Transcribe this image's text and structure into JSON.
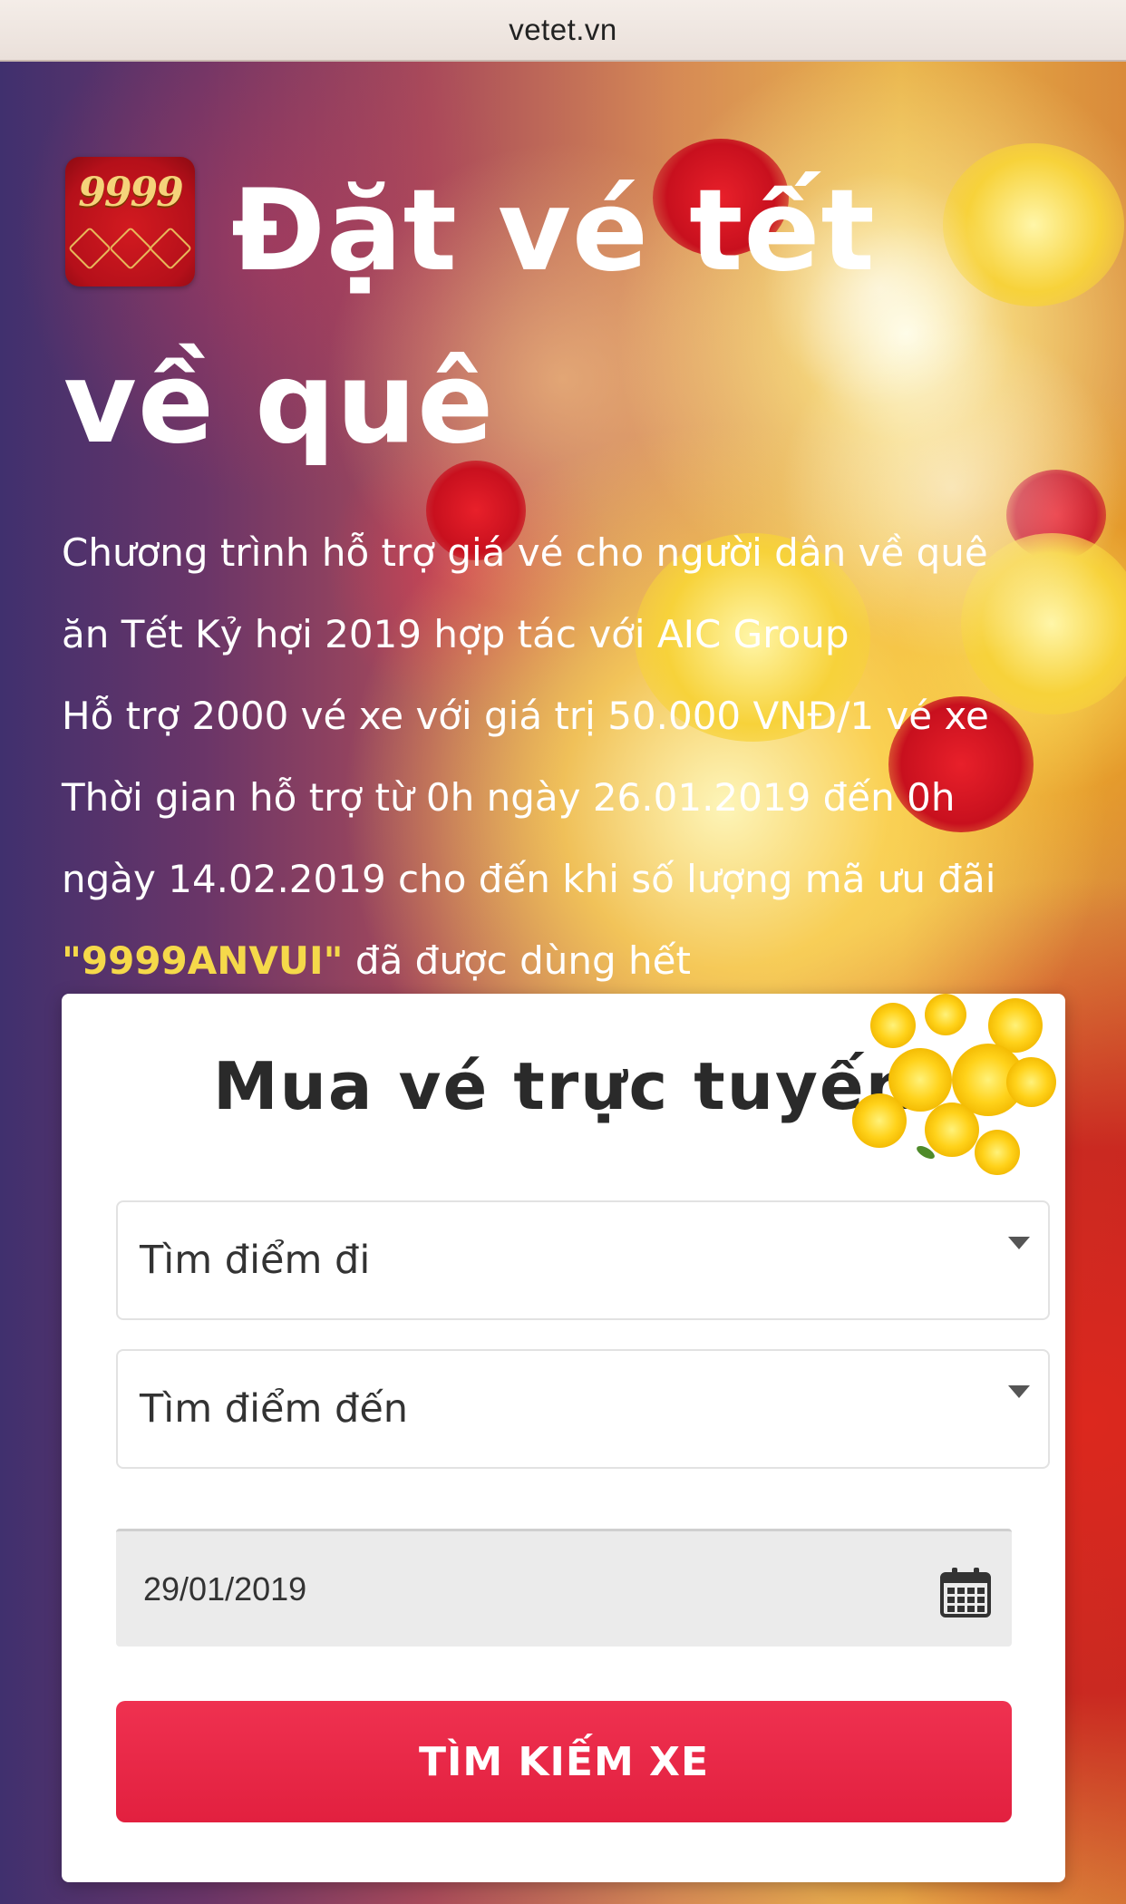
{
  "browser": {
    "url": "vetet.vn"
  },
  "hero": {
    "app_icon_text": "9999",
    "headline": "Đặt vé tết về quê",
    "description_lines": [
      "Chương trình hỗ trợ giá vé cho người dân về quê",
      "ăn Tết Kỷ hợi 2019 hợp tác với AIC Group",
      "Hỗ trợ 2000 vé xe với giá trị 50.000 VNĐ/1 vé xe",
      "Thời gian hỗ trợ từ 0h ngày 26.01.2019 đến 0h",
      "ngày 14.02.2019 cho đến khi số lượng mã ưu đãi"
    ],
    "promo_code": "\"9999ANVUI\"",
    "promo_suffix": " đã được dùng hết"
  },
  "booking": {
    "title": "Mua vé trực tuyến",
    "origin": {
      "placeholder": "Tìm điểm đi"
    },
    "destination": {
      "placeholder": "Tìm điểm đến"
    },
    "date": {
      "value": "29/01/2019",
      "icon": "calendar-icon"
    },
    "search_label": "TÌM KIẾM XE"
  },
  "colors": {
    "accent_button": "#e8263f",
    "promo_code": "#f5d94a"
  }
}
